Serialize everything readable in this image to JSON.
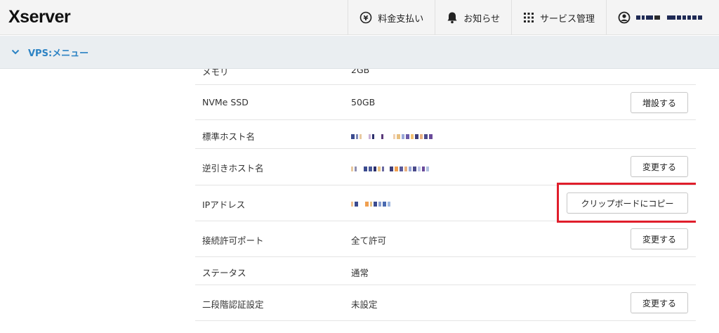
{
  "header": {
    "logo": "Xserver",
    "nav": [
      {
        "label": "料金支払い",
        "icon": "yen-circle-icon"
      },
      {
        "label": "お知らせ",
        "icon": "bell-icon"
      },
      {
        "label": "サービス管理",
        "icon": "grid-icon"
      }
    ],
    "user_icon": "user-circle-icon"
  },
  "subheader": {
    "label": "VPS:メニュー"
  },
  "table": {
    "rows": [
      {
        "label": "メモリ",
        "value": "2GB"
      },
      {
        "label": "NVMe SSD",
        "value": "50GB",
        "button": "増設する"
      },
      {
        "label": "標準ホスト名",
        "value": ""
      },
      {
        "label": "逆引きホスト名",
        "value": "",
        "button": "変更する"
      },
      {
        "label": "IPアドレス",
        "value": "",
        "button": "クリップボードにコピー"
      },
      {
        "label": "接続許可ポート",
        "value": "全て許可",
        "button": "変更する"
      },
      {
        "label": "ステータス",
        "value": "通常"
      },
      {
        "label": "二段階認証設定",
        "value": "未設定",
        "button": "変更する"
      }
    ]
  },
  "colors": {
    "accent": "#2c83c4",
    "highlight": "#e01e2b"
  }
}
